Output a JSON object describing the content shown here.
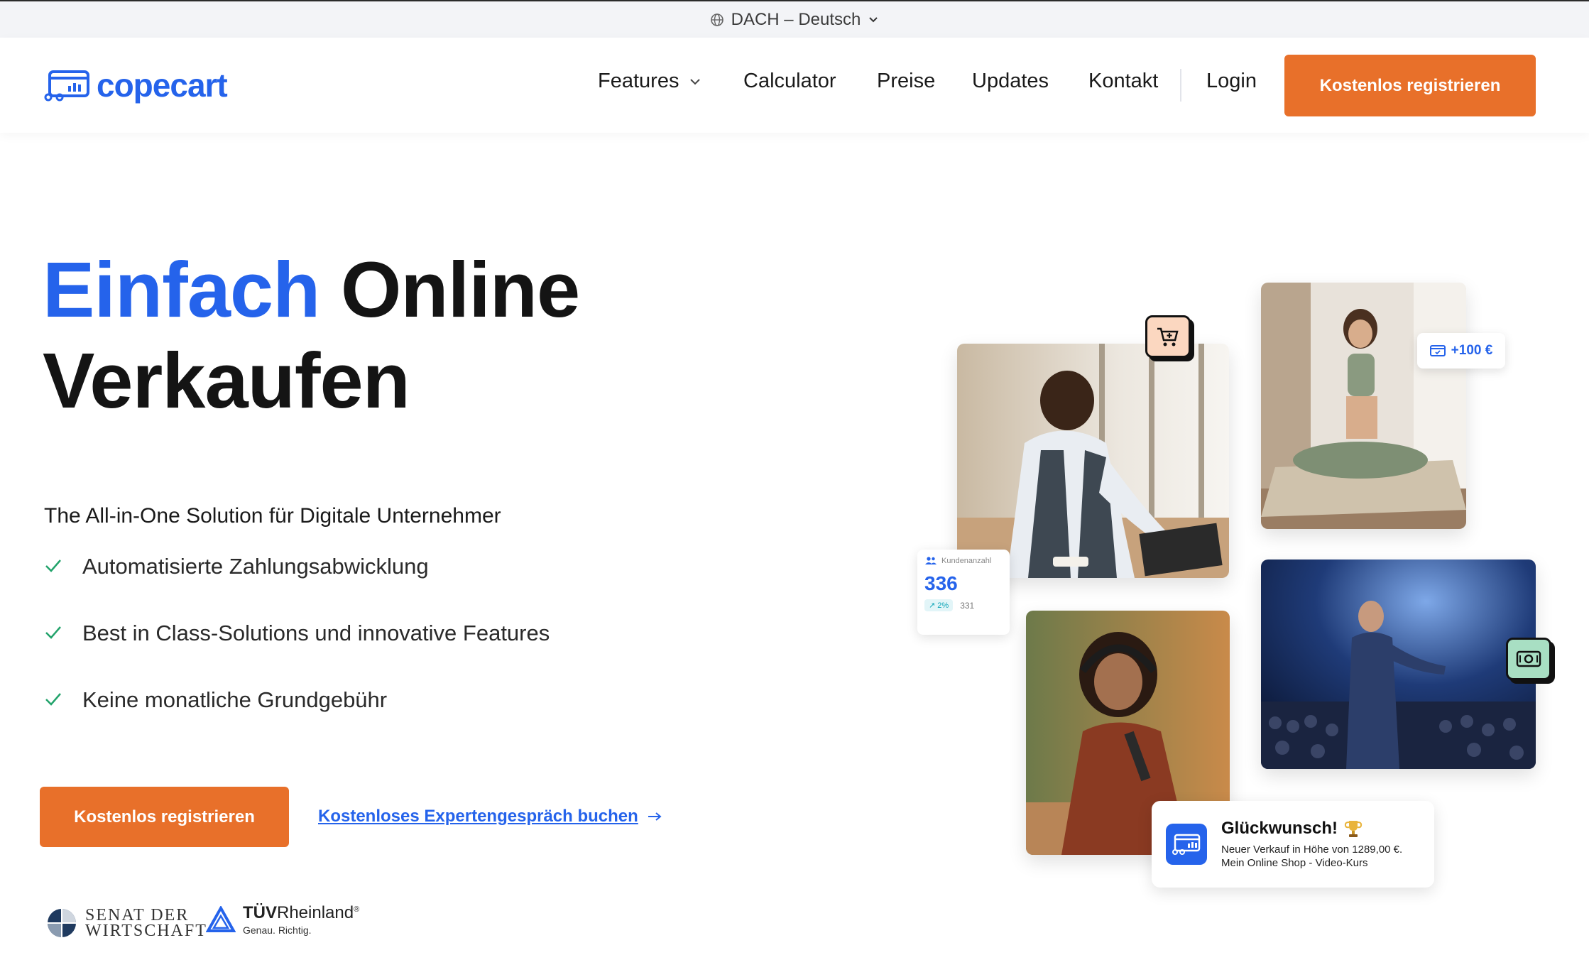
{
  "locale": {
    "label": "DACH – Deutsch"
  },
  "brand": {
    "name": "copecart",
    "color": "#2563eb",
    "accent": "#e8702a"
  },
  "nav": {
    "items": [
      {
        "label": "Features",
        "has_dropdown": true
      },
      {
        "label": "Calculator"
      },
      {
        "label": "Preise"
      },
      {
        "label": "Updates"
      },
      {
        "label": "Kontakt"
      }
    ],
    "login": "Login",
    "cta": "Kostenlos registrieren"
  },
  "hero": {
    "title_highlight": "Einfach",
    "title_rest_1": "Online",
    "title_rest_2": "Verkaufen",
    "subtitle": "The All-in-One Solution für Digitale Unternehmer",
    "features": [
      "Automatisierte Zahlungsabwicklung",
      "Best in Class-Solutions und innovative Features",
      "Keine monatliche Grundgebühr"
    ],
    "cta_primary": "Kostenlos registrieren",
    "cta_secondary": "Kostenloses Expertengespräch buchen"
  },
  "trust": {
    "senat_line1": "SENAT DER",
    "senat_line2": "WIRTSCHAFT",
    "tuv_bold": "TÜV",
    "tuv_rest": "Rheinland",
    "tuv_reg": "®",
    "tuv_tagline": "Genau. Richtig."
  },
  "widgets": {
    "plus_badge": "+100 €",
    "kunden_label": "Kundenanzahl",
    "kunden_value": "336",
    "kunden_change": "2%",
    "kunden_prev": "331",
    "congrats_title": "Glückwunsch!",
    "congrats_line1": "Neuer Verkauf in Höhe von 1289,00 €.",
    "congrats_line2": "Mein Online Shop - Video-Kurs"
  },
  "icons": [
    "globe-icon",
    "chevron-down-icon",
    "check-icon",
    "arrow-right-icon",
    "cart-plus-icon",
    "cash-icon",
    "card-check-icon",
    "users-icon",
    "trophy-icon",
    "card-register-icon"
  ]
}
